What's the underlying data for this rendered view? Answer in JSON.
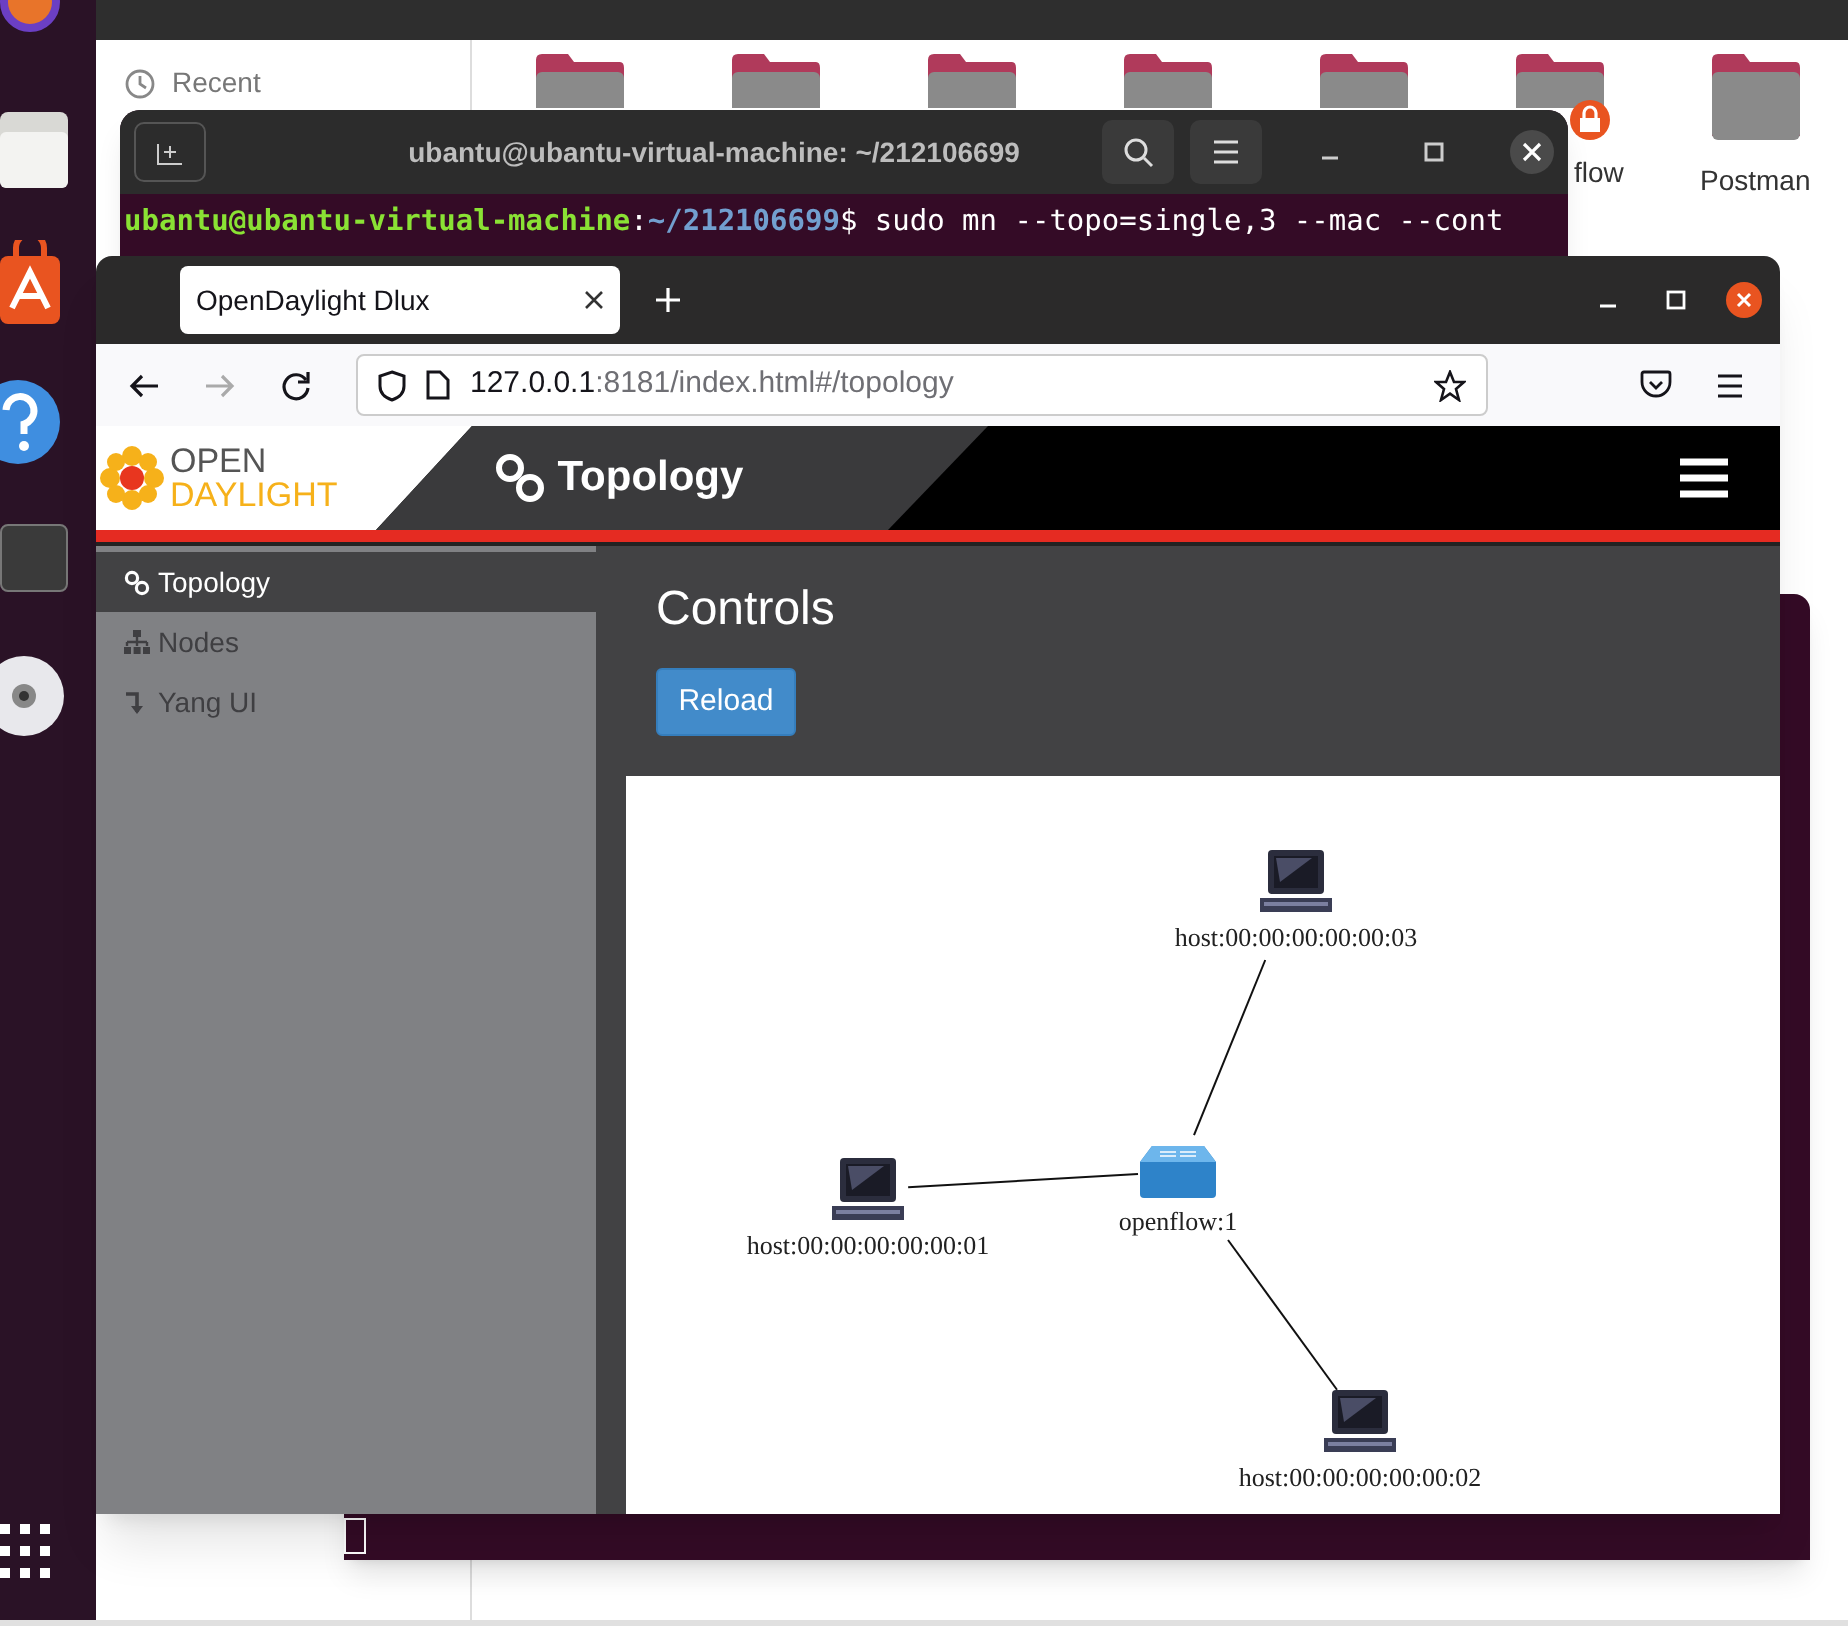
{
  "files_window": {
    "sidebar_items": [
      "Recent"
    ],
    "folders": [
      {
        "badge": false
      },
      {
        "badge": false
      },
      {
        "badge": false
      },
      {
        "badge": false
      },
      {
        "badge": false
      },
      {
        "badge": true,
        "label": "flow"
      },
      {
        "badge": false,
        "label": "Postman"
      }
    ]
  },
  "terminal": {
    "title": "ubantu@ubantu-virtual-machine: ~/212106699",
    "line": [
      {
        "kind": "user",
        "text": "ubantu@ubantu-virtual-machine"
      },
      {
        "kind": "plain",
        "text": ":"
      },
      {
        "kind": "path",
        "text": "~/212106699"
      },
      {
        "kind": "plain",
        "text": "$ sudo mn --topo=single,3 --mac --cont"
      }
    ]
  },
  "browser": {
    "tab_title": "OpenDaylight Dlux",
    "url_host": "127.0.0.1",
    "url_rest": ":8181/index.html#/topology"
  },
  "app": {
    "logo_top": "OPEN",
    "logo_bottom": "DAYLIGHT",
    "page_title": "Topology",
    "nav_items": [
      {
        "kind": "topology",
        "label": "Topology",
        "selected": true
      },
      {
        "kind": "nodes",
        "label": "Nodes",
        "selected": false
      },
      {
        "kind": "yang",
        "label": "Yang UI",
        "selected": false
      }
    ],
    "heading": "Controls",
    "button": "Reload",
    "graph": {
      "nodes": [
        {
          "kind": "host",
          "label": "host:00:00:00:00:00:03"
        },
        {
          "kind": "host",
          "label": "host:00:00:00:00:00:01"
        },
        {
          "kind": "switch",
          "label": "openflow:1"
        },
        {
          "kind": "host",
          "label": "host:00:00:00:00:00:02"
        }
      ]
    }
  }
}
